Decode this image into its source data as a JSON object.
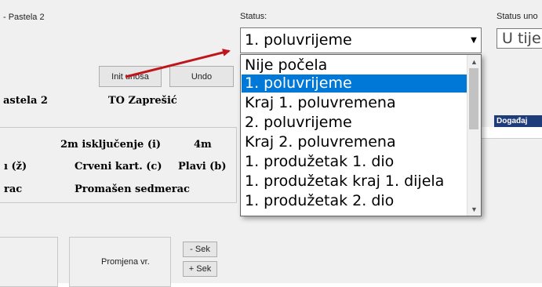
{
  "header": {
    "title": "- Pastela 2"
  },
  "status": {
    "label": "Status:",
    "selected": "1. poluvrijeme"
  },
  "status_uno": {
    "label": "Status uno",
    "value": "U tije"
  },
  "buttons": {
    "init": "Init unosa",
    "undo": "Undo",
    "promjena": "Promjena vr.",
    "minus_sek": "- Sek",
    "plus_sek": "+ Sek"
  },
  "teams": {
    "home": "astela 2",
    "away": "TO Zaprešić"
  },
  "stats": {
    "row1_a": "2m isključenje (i)",
    "row1_b": "4m",
    "row2_a": "ı (ž)",
    "row2_b": "Crveni kart. (c)",
    "row2_c": "Plavi (b)",
    "row3_a": "rac",
    "row3_b": "Promašen sedmerac"
  },
  "grid": {
    "column": "Događaj"
  },
  "dropdown": {
    "items": [
      "Nije počela",
      "1. poluvrijeme",
      "Kraj 1. poluvremena",
      "2. poluvrijeme",
      "Kraj 2. poluvremena",
      "1. produžetak 1. dio",
      "1. produžetak kraj 1. dijela",
      "1. produžetak 2. dio"
    ],
    "selected_index": 1
  },
  "colors": {
    "selection": "#0078d7",
    "annotation_arrow": "#c0161b",
    "grid_header": "#1f3c7a"
  }
}
